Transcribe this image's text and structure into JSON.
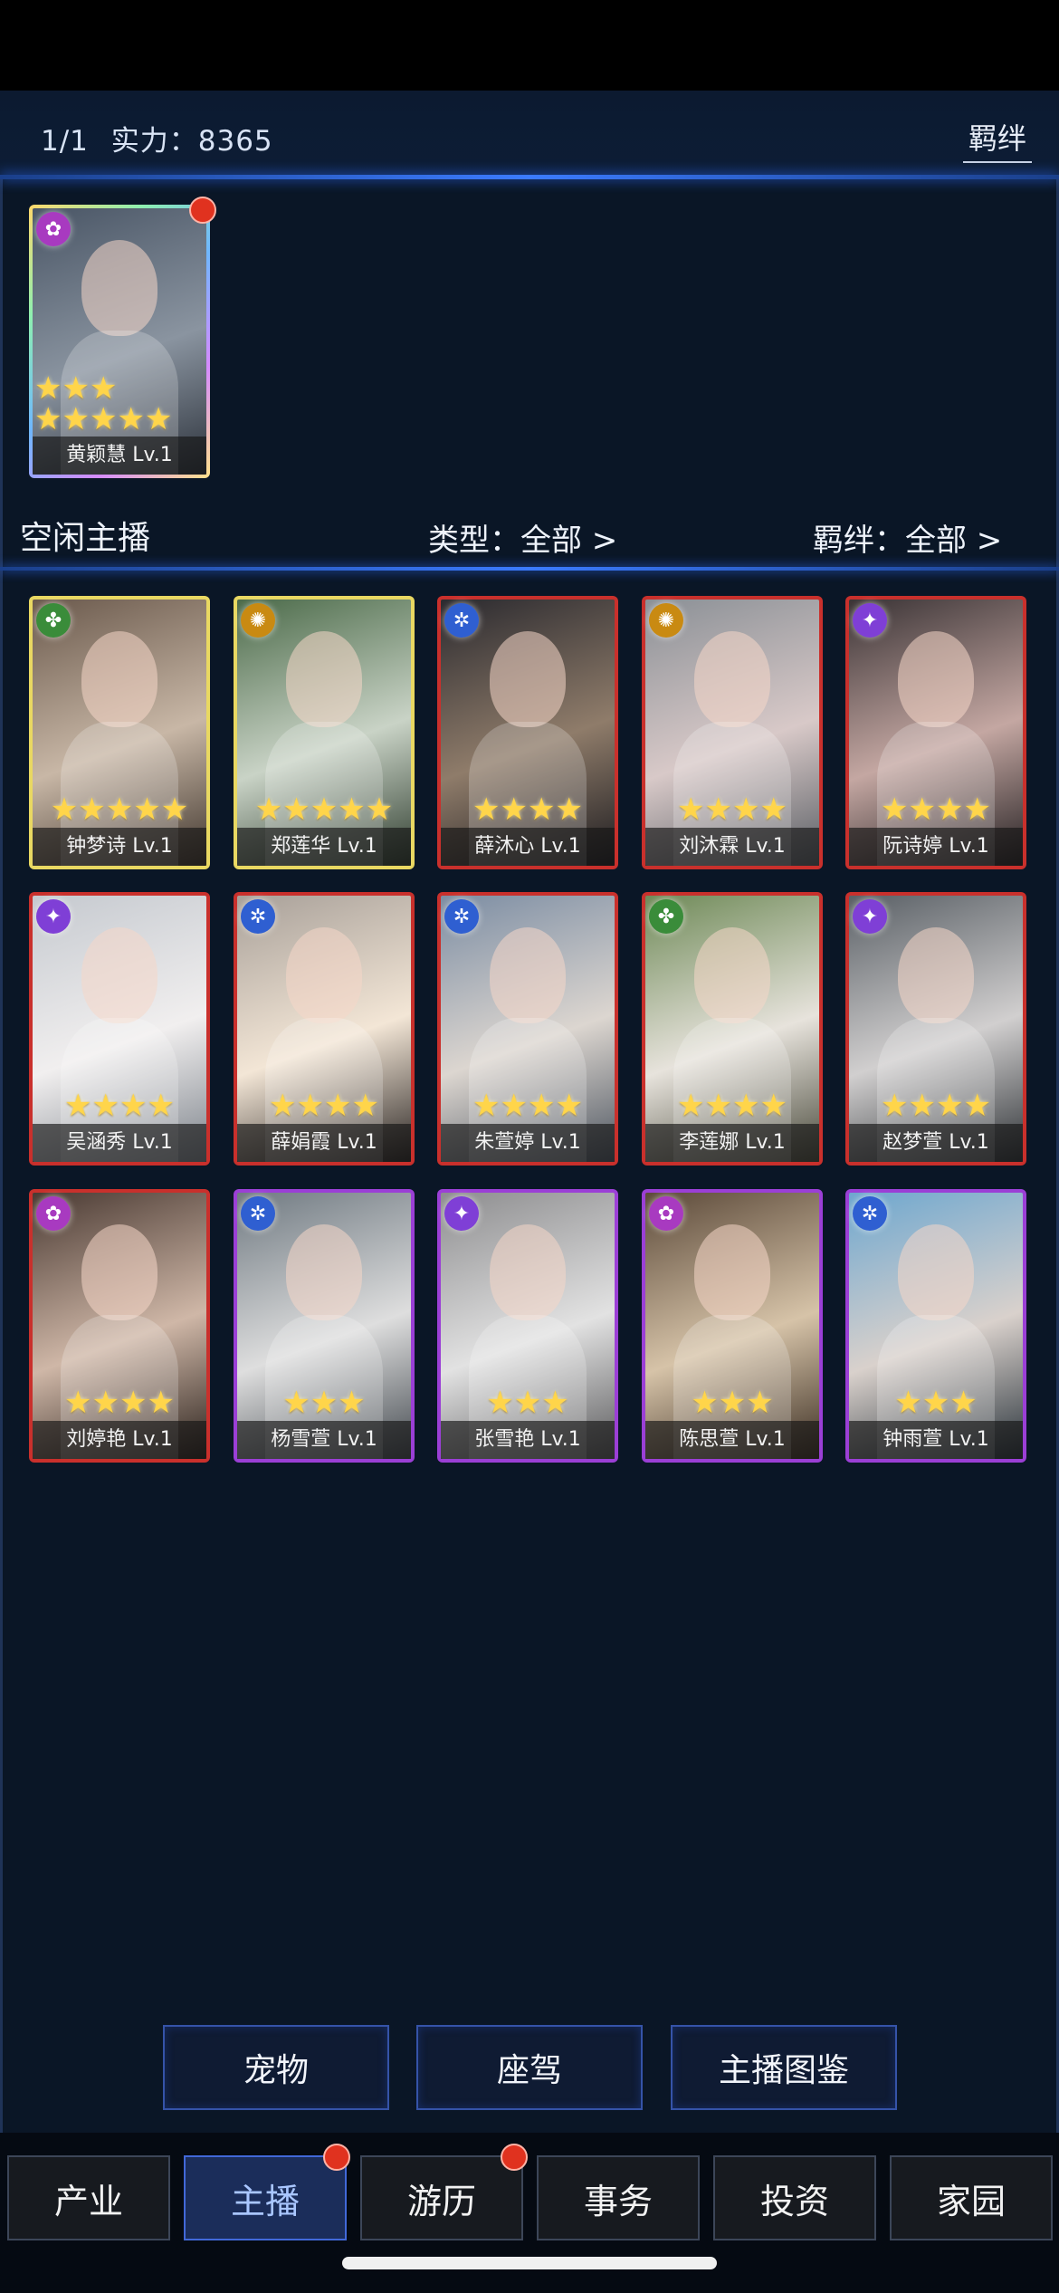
{
  "header": {
    "page": "1/1",
    "power_label": "实力：8365",
    "bond_link": "羁绊"
  },
  "active_slot": {
    "name": "黄颖慧 Lv.1",
    "stars": 8,
    "emblem": "purple-rose-icon",
    "frame": "rainbow"
  },
  "idle_section": {
    "title": "空闲主播",
    "type_filter": "类型：全部 >",
    "bond_filter": "羁绊：全部 >"
  },
  "hosts": [
    {
      "name": "钟梦诗 Lv.1",
      "stars": 5,
      "emblem": "green-leaf-icon",
      "frame": "#e9d862",
      "emblem_color": "#3a8c3a"
    },
    {
      "name": "郑莲华 Lv.1",
      "stars": 5,
      "emblem": "gold-sun-icon",
      "frame": "#e9d862",
      "emblem_color": "#c98a12"
    },
    {
      "name": "薛沐心 Lv.1",
      "stars": 4,
      "emblem": "blue-wave-icon",
      "frame": "#c9302c",
      "emblem_color": "#2f5fd1"
    },
    {
      "name": "刘沐霖 Lv.1",
      "stars": 4,
      "emblem": "gold-sun-icon",
      "frame": "#c9302c",
      "emblem_color": "#c98a12"
    },
    {
      "name": "阮诗婷 Lv.1",
      "stars": 4,
      "emblem": "purple-star-icon",
      "frame": "#c9302c",
      "emblem_color": "#7f3fd6"
    },
    {
      "name": "吴涵秀 Lv.1",
      "stars": 4,
      "emblem": "purple-star-icon",
      "frame": "#c9302c",
      "emblem_color": "#7f3fd6"
    },
    {
      "name": "薛娟霞 Lv.1",
      "stars": 4,
      "emblem": "blue-wave-icon",
      "frame": "#c9302c",
      "emblem_color": "#2f5fd1"
    },
    {
      "name": "朱萱婷 Lv.1",
      "stars": 4,
      "emblem": "blue-wave-icon",
      "frame": "#c9302c",
      "emblem_color": "#2f5fd1"
    },
    {
      "name": "李莲娜 Lv.1",
      "stars": 4,
      "emblem": "green-leaf-icon",
      "frame": "#c9302c",
      "emblem_color": "#3a8c3a"
    },
    {
      "name": "赵梦萱 Lv.1",
      "stars": 4,
      "emblem": "purple-star-icon",
      "frame": "#c9302c",
      "emblem_color": "#7f3fd6"
    },
    {
      "name": "刘婷艳 Lv.1",
      "stars": 4,
      "emblem": "purple-rose-icon",
      "frame": "#c9302c",
      "emblem_color": "#a83ac0"
    },
    {
      "name": "杨雪萱 Lv.1",
      "stars": 3,
      "emblem": "blue-wave-icon",
      "frame": "#9b3fd6",
      "emblem_color": "#2f5fd1"
    },
    {
      "name": "张雪艳 Lv.1",
      "stars": 3,
      "emblem": "purple-star-icon",
      "frame": "#9b3fd6",
      "emblem_color": "#7f3fd6"
    },
    {
      "name": "陈思萱 Lv.1",
      "stars": 3,
      "emblem": "purple-rose-icon",
      "frame": "#9b3fd6",
      "emblem_color": "#a83ac0"
    },
    {
      "name": "钟雨萱 Lv.1",
      "stars": 3,
      "emblem": "blue-wave-icon",
      "frame": "#9b3fd6",
      "emblem_color": "#2f5fd1"
    }
  ],
  "function_buttons": {
    "pet": "宠物",
    "vehicle": "座驾",
    "catalog": "主播图鉴"
  },
  "nav": {
    "industry": "产业",
    "host": "主播",
    "travel": "游历",
    "affairs": "事务",
    "invest": "投资",
    "home": "家园"
  }
}
